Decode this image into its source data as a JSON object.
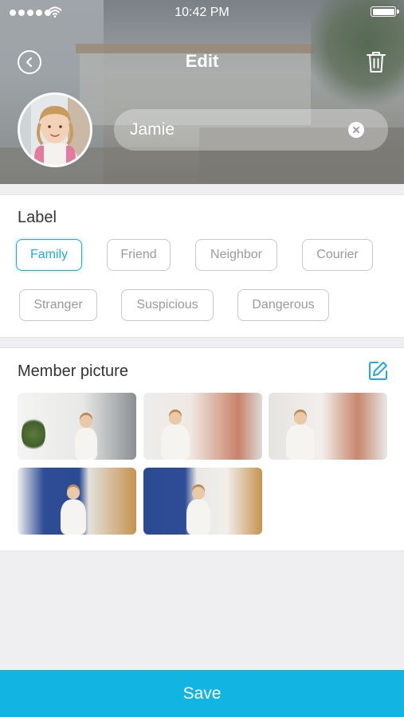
{
  "status_bar": {
    "time": "10:42 PM",
    "signal_icon": "signal-dots-icon",
    "wifi_icon": "wifi-icon",
    "battery_icon": "battery-icon",
    "battery_level": 1.0
  },
  "nav": {
    "title": "Edit",
    "back_icon": "chevron-left-circle-icon",
    "delete_icon": "trash-icon"
  },
  "profile": {
    "name": "Jamie",
    "clear_icon": "clear-x-circle-icon"
  },
  "label_section": {
    "title": "Label",
    "selected": "Family",
    "labels": [
      "Family",
      "Friend",
      "Neighbor",
      "Courier",
      "Stranger",
      "Suspicious",
      "Dangerous"
    ]
  },
  "member_picture": {
    "title": "Member picture",
    "edit_icon": "edit-pencil-icon",
    "photo_count": 5
  },
  "save_label": "Save",
  "colors": {
    "accent": "#22a9e0",
    "save_bar": "#12b4e2",
    "chip_border": "#c8c8c8",
    "chip_text": "#9a9a9a",
    "page_bg": "#efeff1"
  }
}
